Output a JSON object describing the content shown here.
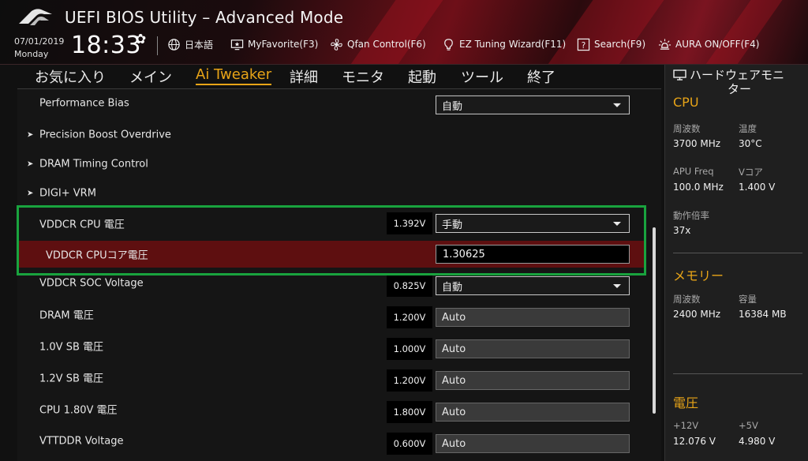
{
  "header": {
    "title": "UEFI BIOS Utility – Advanced Mode",
    "date": "07/01/2019",
    "day": "Monday",
    "time": "18:33",
    "items": [
      {
        "icon": "globe-icon",
        "label": "日本語"
      },
      {
        "icon": "star-monitor-icon",
        "label": "MyFavorite(F3)"
      },
      {
        "icon": "fan-icon",
        "label": "Qfan Control(F6)"
      },
      {
        "icon": "lightbulb-icon",
        "label": "EZ Tuning Wizard(F11)"
      },
      {
        "icon": "help-icon",
        "label": "Search(F9)"
      },
      {
        "icon": "aura-icon",
        "label": "AURA ON/OFF(F4)"
      }
    ]
  },
  "tabs": [
    "お気に入り",
    "メイン",
    "Ai Tweaker",
    "詳細",
    "モニタ",
    "起動",
    "ツール",
    "終了"
  ],
  "active_tab": "Ai Tweaker",
  "settings": [
    {
      "label": "Performance Bias",
      "control": "select",
      "value": "自動"
    },
    {
      "label": "Precision Boost Overdrive",
      "submenu": true
    },
    {
      "label": "DRAM Timing Control",
      "submenu": true
    },
    {
      "label": "DIGI+ VRM",
      "submenu": true
    },
    {
      "label": "VDDCR CPU 電圧",
      "current": "1.392V",
      "control": "select",
      "value": "手動"
    },
    {
      "label": "VDDCR CPUコア電圧",
      "control": "input",
      "value": "1.30625",
      "selected": true
    },
    {
      "label": "VDDCR SOC Voltage",
      "current": "0.825V",
      "control": "select",
      "value": "自動"
    },
    {
      "label": "DRAM 電圧",
      "current": "1.200V",
      "control": "auto",
      "value": "Auto"
    },
    {
      "label": "1.0V SB 電圧",
      "current": "1.000V",
      "control": "auto",
      "value": "Auto"
    },
    {
      "label": "1.2V SB 電圧",
      "current": "1.200V",
      "control": "auto",
      "value": "Auto"
    },
    {
      "label": "CPU 1.80V 電圧",
      "current": "1.800V",
      "control": "auto",
      "value": "Auto"
    },
    {
      "label": "VTTDDR Voltage",
      "current": "0.600V",
      "control": "auto",
      "value": "Auto"
    }
  ],
  "monitor": {
    "title_line1": "ハードウェアモニ",
    "title_line2": "ター",
    "cpu": {
      "title": "CPU",
      "freq_label": "周波数",
      "freq": "3700 MHz",
      "temp_label": "温度",
      "temp": "30°C",
      "apu_label": "APU Freq",
      "apu": "100.0 MHz",
      "vcore_label": "Vコア",
      "vcore": "1.400 V",
      "ratio_label": "動作倍率",
      "ratio": "37x"
    },
    "memory": {
      "title": "メモリー",
      "freq_label": "周波数",
      "freq": "2400 MHz",
      "cap_label": "容量",
      "cap": "16384 MB"
    },
    "voltage": {
      "title": "電圧",
      "v12_label": "+12V",
      "v12": "12.076 V",
      "v5_label": "+5V",
      "v5": "4.980 V"
    }
  },
  "colors": {
    "accent": "#e8a417",
    "selected_row": "#5e0f10",
    "highlight": "#19a33e"
  }
}
